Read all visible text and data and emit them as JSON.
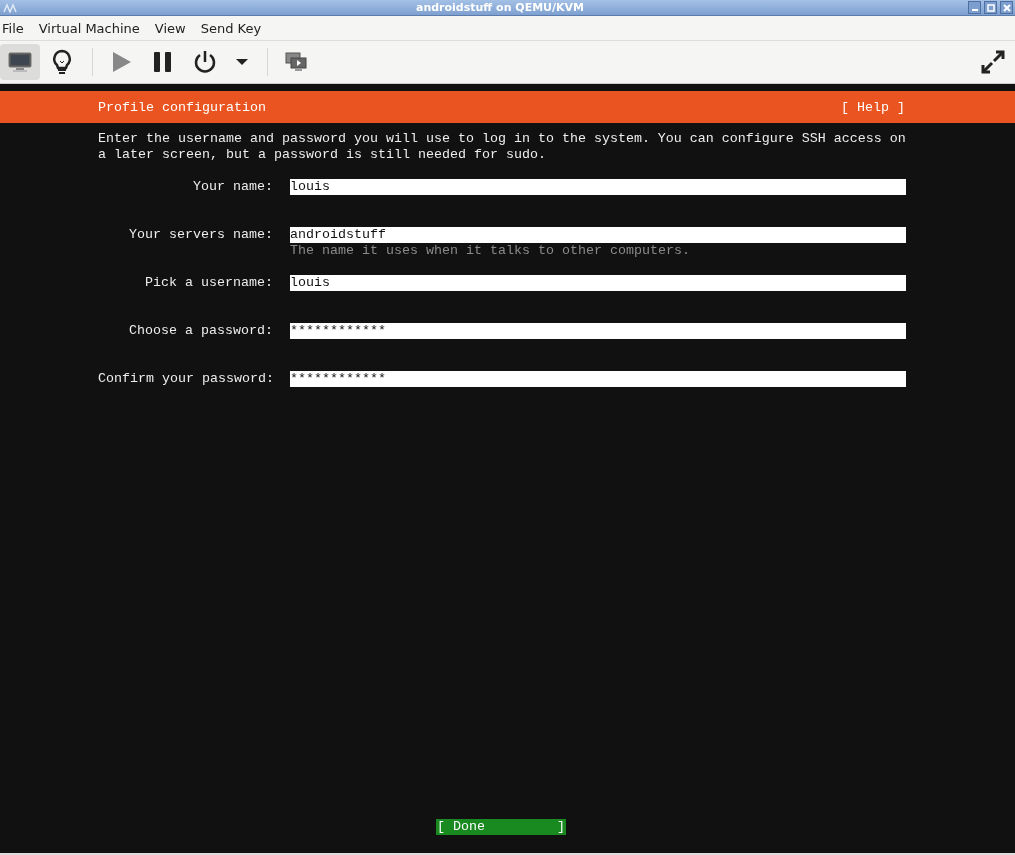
{
  "window": {
    "title": "androidstuff on QEMU/KVM"
  },
  "menu": [
    "File",
    "Virtual Machine",
    "View",
    "Send Key"
  ],
  "toolbar": [
    {
      "kind": "console",
      "selected": true
    },
    {
      "kind": "details",
      "selected": false
    },
    {
      "kind": "run",
      "selected": false,
      "disabled": true
    },
    {
      "kind": "pause",
      "selected": false,
      "disabled": false
    },
    {
      "kind": "power",
      "selected": false,
      "disabled": false
    },
    {
      "kind": "dropdown",
      "selected": false,
      "disabled": false
    },
    {
      "kind": "snapshots",
      "selected": false
    }
  ],
  "installer": {
    "header": "Profile configuration",
    "help_button": "[ Help ]",
    "intro": "Enter the username and password you will use to log in to the system. You can configure SSH access on a later screen, but a password is still needed for sudo.",
    "fields": [
      {
        "label": "Your name:",
        "value": "louis"
      },
      {
        "label": "Your servers name:",
        "value": "androidstuff",
        "hint": "The name it uses when it talks to other computers."
      },
      {
        "label": "Pick a username:",
        "value": "louis"
      },
      {
        "label": "Choose a password:",
        "value": "************"
      },
      {
        "label": "Confirm your password:",
        "value": "************"
      }
    ],
    "done_button": "[ Done         ]"
  }
}
